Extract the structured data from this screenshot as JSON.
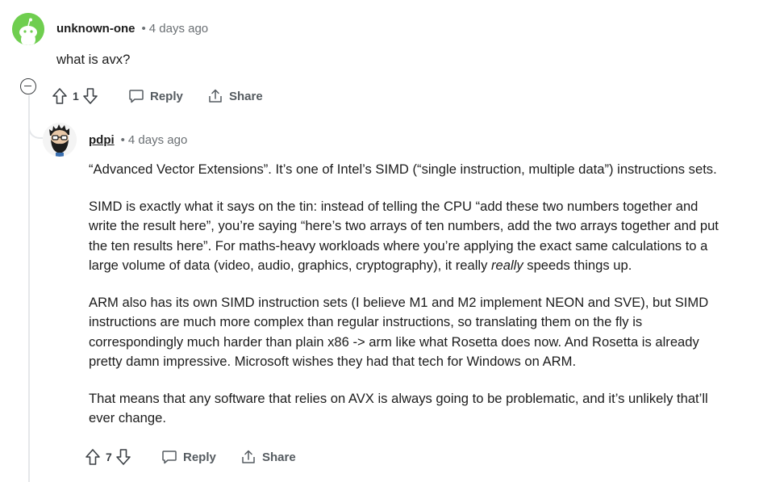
{
  "comment1": {
    "username": "unknown-one",
    "separator": "•",
    "timestamp": "4 days ago",
    "text": "what is avx?",
    "votes": "1",
    "reply_label": "Reply",
    "share_label": "Share"
  },
  "comment2": {
    "username": "pdpi",
    "separator": "•",
    "timestamp": "4 days ago",
    "paragraphs": {
      "p1": "“Advanced Vector Extensions”. It’s one of Intel’s SIMD (“single instruction, multiple data”) instructions sets.",
      "p2_line1": "SIMD is exactly what it says on the tin: instead of telling the CPU “add these two numbers together and",
      "p2_line2": "write the result here”, you’re saying “here’s two arrays of ten numbers, add the two arrays together and put",
      "p2_line3": "the ten results here”. For maths-heavy workloads where you’re applying the exact same calculations to a",
      "p2_line4_a": "large volume of data (video, audio, graphics, cryptography), it really ",
      "p2_line4_em": "really",
      "p2_line4_b": " speeds things up.",
      "p3_line1": "ARM also has its own SIMD instruction sets (I believe M1 and M2 implement NEON and SVE), but SIMD",
      "p3_line2": "instructions are much more complex than regular instructions, so translating them on the fly is",
      "p3_line3": "correspondingly much harder than plain x86 -> arm like what Rosetta does now. And Rosetta is already",
      "p3_line4": "pretty damn impressive. Microsoft wishes they had that tech for Windows on ARM.",
      "p4_line1": "That means that any software that relies on AVX is always going to be problematic, and it’s unlikely that’ll",
      "p4_line2": "ever change."
    },
    "votes": "7",
    "reply_label": "Reply",
    "share_label": "Share"
  },
  "icons": {
    "upvote": "arrow-up-icon",
    "downvote": "arrow-down-icon",
    "reply": "speech-bubble-icon",
    "share": "share-icon",
    "collapse": "minus-circle-icon",
    "avatar1": "snoo-avatar-icon",
    "avatar2": "bearded-avatar-icon"
  },
  "colors": {
    "avatar_green": "#6fce4f",
    "thread_line": "#e5e7ea",
    "meta_grey": "#6a6f73",
    "action_grey": "#555b60"
  }
}
